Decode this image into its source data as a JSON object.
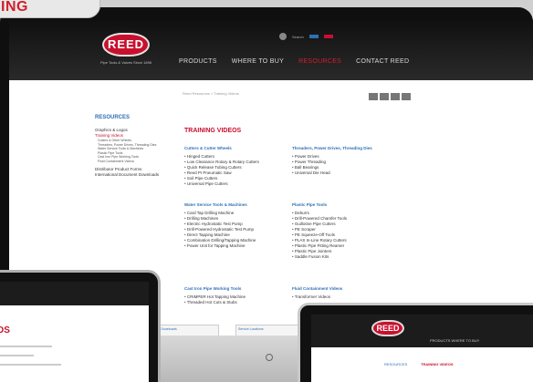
{
  "banner": {
    "text": "ING"
  },
  "header": {
    "logo_text": "REED",
    "logo_sub": "Pipe Tools & Valves Since 1896",
    "nav": [
      "PRODUCTS",
      "WHERE TO BUY",
      "RESOURCES",
      "CONTACT REED"
    ],
    "active_nav_index": 2,
    "top_links": [
      "Search",
      "Login"
    ]
  },
  "breadcrumb": "Reed Resources > Training Videos",
  "sidebar": {
    "title": "RESOURCES",
    "items": [
      {
        "label": "Graphics & Logos",
        "red": false
      },
      {
        "label": "Training Videos",
        "red": true
      }
    ],
    "sub_items": [
      "Cutters & Other Wheels",
      "Threaders, Power Drives, Threading Dies",
      "Water Service Tools & Machines",
      "Plastic Pipe Tools",
      "Cast Iron Pipe Working Tools",
      "Fluid Containment Videos"
    ],
    "tail_items": [
      "Distributor Product Forms",
      "International Document Downloads"
    ]
  },
  "content": {
    "title": "TRAINING VIDEOS",
    "columns": [
      {
        "heading": "Cutters & Cutter Wheels",
        "items": [
          "Hinged Cutters",
          "Low Clearance Rotary & Rotary Cutters",
          "Quick Release Tubing Cutters",
          "Reed PI Pneumatic Saw",
          "Soil Pipe Cutters",
          "Universal Pipe Cutters"
        ]
      },
      {
        "heading": "Threaders, Power Drives, Threading Dies",
        "items": [
          "Power Drives",
          "Power Threading",
          "Ball Bearings",
          "Universal Die Head"
        ]
      },
      {
        "heading": "Water Service Tools & Machines",
        "items": [
          "Card Tap Drilling Machine",
          "Drilling Machines",
          "Electric Hydrostatic Test Pump",
          "Drill-Powered Hydrostatic Test Pump",
          "Direct Tapping Machine",
          "Combination Drilling/Tapping Machine",
          "Power Unit for Tapping Machine"
        ]
      },
      {
        "heading": "Plastic Pipe Tools",
        "items": [
          "Deburrs",
          "Drill-Powered Chamfer Tools",
          "Guillotine Pipe Cutters",
          "PE Scraper",
          "PE Squeeze-Off Tools",
          "PLAS In-Line Rotary Cutters",
          "Plastic Pipe Fitting Reamer",
          "Plastic Pipe Jointers",
          "Saddle Fusion Kits"
        ]
      },
      {
        "heading": "Cast Iron Pipe Working Tools",
        "items": [
          "CRIMPER Hot Tapping Machine",
          "Threaded Hot Cuts & Stubs"
        ]
      },
      {
        "heading": "Fluid Containment Videos",
        "items": [
          "Transformer Videos"
        ]
      }
    ]
  },
  "footer_boxes": [
    "Training Downloads",
    "Service Locations"
  ],
  "tablet_left": {
    "title": "DS"
  },
  "tablet_right": {
    "logo_text": "REED",
    "nav": "PRODUCTS   WHERE TO BUY",
    "title": "TRAINING VIDEOS",
    "subtitle": "RESOURCES"
  },
  "colors": {
    "brand_red": "#c8102e",
    "link_blue": "#2f6fb4",
    "header_dark": "#1c1c1c"
  }
}
